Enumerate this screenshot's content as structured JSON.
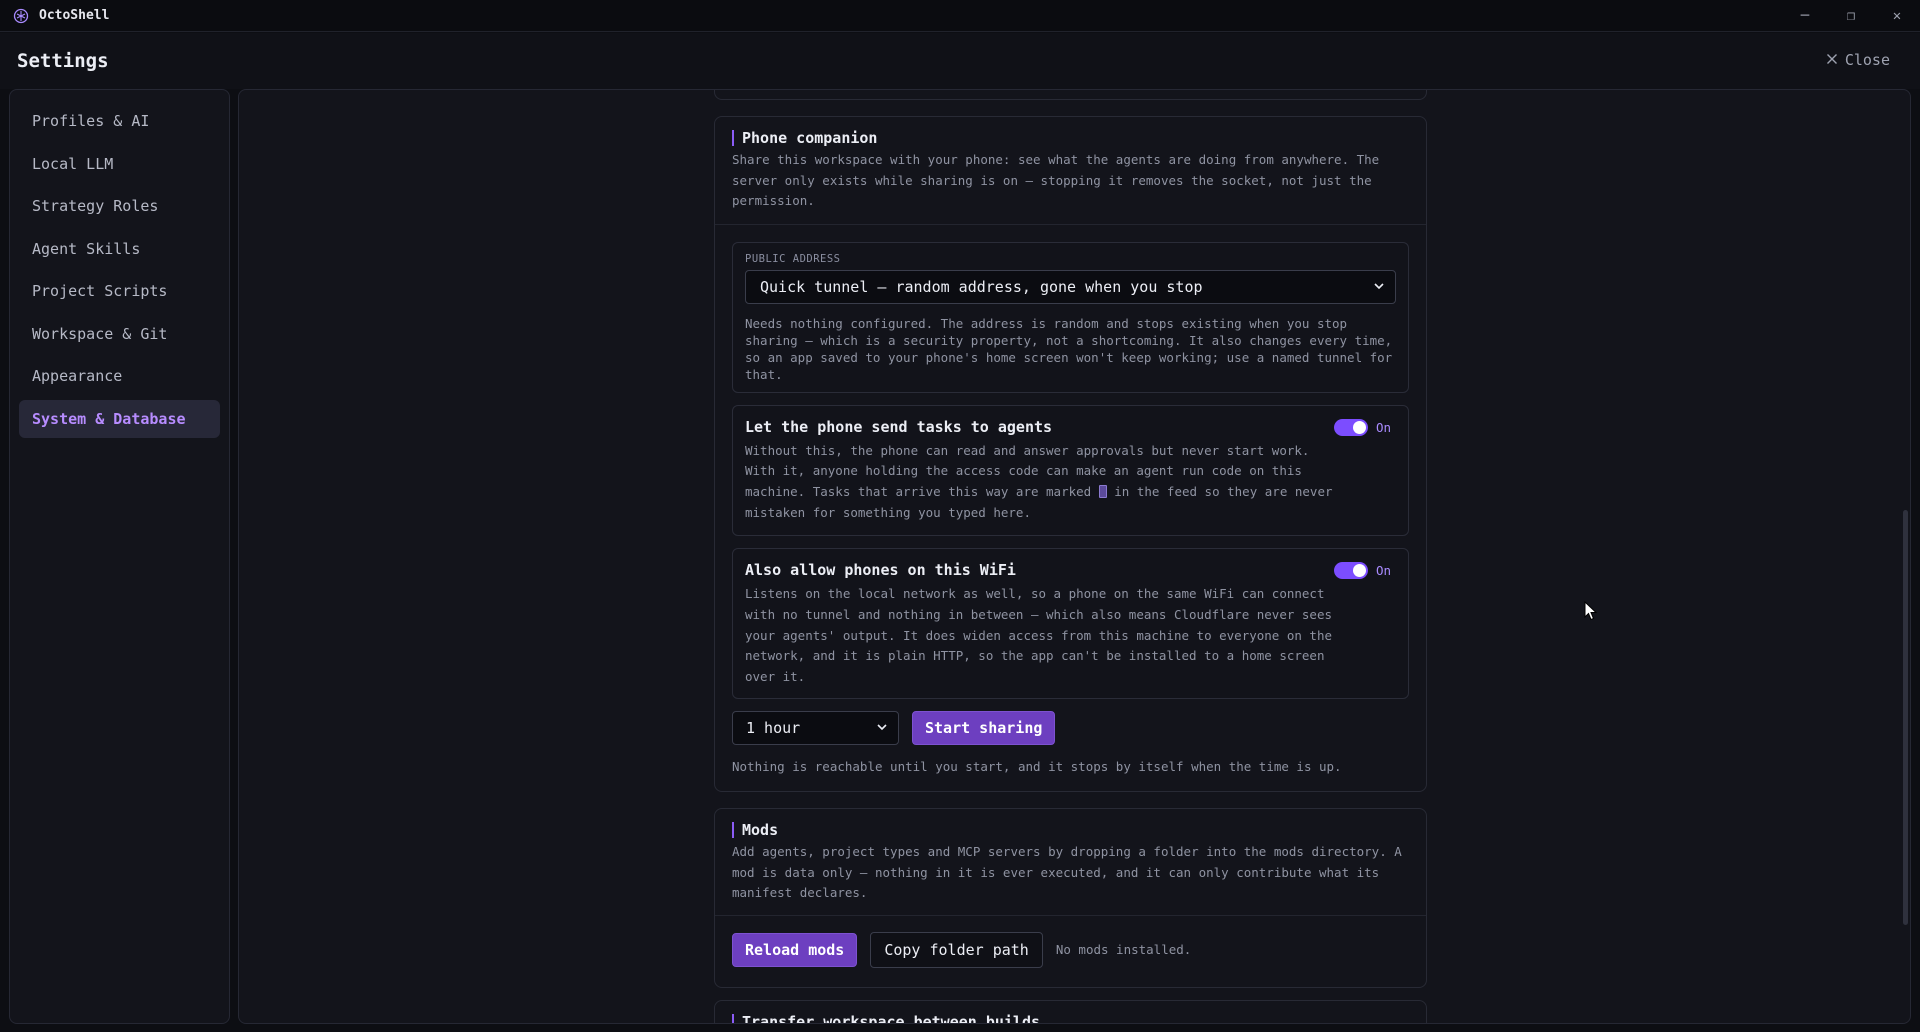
{
  "app": {
    "name": "OctoShell"
  },
  "window_controls": {
    "minimize": "─",
    "restore": "❐",
    "close": "✕"
  },
  "header": {
    "title": "Settings",
    "close_label": "Close"
  },
  "sidebar": {
    "items": [
      {
        "label": "Profiles & AI"
      },
      {
        "label": "Local LLM"
      },
      {
        "label": "Strategy Roles"
      },
      {
        "label": "Agent Skills"
      },
      {
        "label": "Project Scripts"
      },
      {
        "label": "Workspace & Git"
      },
      {
        "label": "Appearance"
      },
      {
        "label": "System & Database",
        "active": true
      }
    ]
  },
  "phone": {
    "title": "Phone companion",
    "description": "Share this workspace with your phone: see what the agents are doing from anywhere. The server only exists while sharing is on — stopping it removes the socket, not just the permission.",
    "address": {
      "label": "PUBLIC ADDRESS",
      "selected": "Quick tunnel — random address, gone when you stop",
      "help": "Needs nothing configured. The address is random and stops existing when you stop sharing — which is a security property, not a shortcoming. It also changes every time, so an app saved to your phone's home screen won't keep working; use a named tunnel for that."
    },
    "send_tasks": {
      "title": "Let the phone send tasks to agents",
      "desc_before": "Without this, the phone can read and answer approvals but never start work. With it, anyone holding the access code can make an agent run code on this machine. Tasks that arrive this way are marked",
      "desc_after": "in the feed so they are never mistaken for something you typed here.",
      "state": "On",
      "enabled": true
    },
    "wifi": {
      "title": "Also allow phones on this WiFi",
      "description": "Listens on the local network as well, so a phone on the same WiFi can connect with no tunnel and nothing in between — which also means Cloudflare never sees your agents' output. It does widen access from this machine to everyone on the network, and it is plain HTTP, so the app can't be installed to a home screen over it.",
      "state": "On",
      "enabled": true
    },
    "duration": "1 hour",
    "start_label": "Start sharing",
    "footnote": "Nothing is reachable until you start, and it stops by itself when the time is up."
  },
  "mods": {
    "title": "Mods",
    "description": "Add agents, project types and MCP servers by dropping a folder into the mods directory. A mod is data only — nothing in it is ever executed, and it can only contribute what its manifest declares.",
    "reload_label": "Reload mods",
    "copy_label": "Copy folder path",
    "status": "No mods installed."
  },
  "transfer": {
    "title": "Transfer workspace between builds"
  },
  "colors": {
    "accent": "#8b5cf6",
    "button": "#6d3fc0",
    "active_nav": "#b78cff"
  }
}
